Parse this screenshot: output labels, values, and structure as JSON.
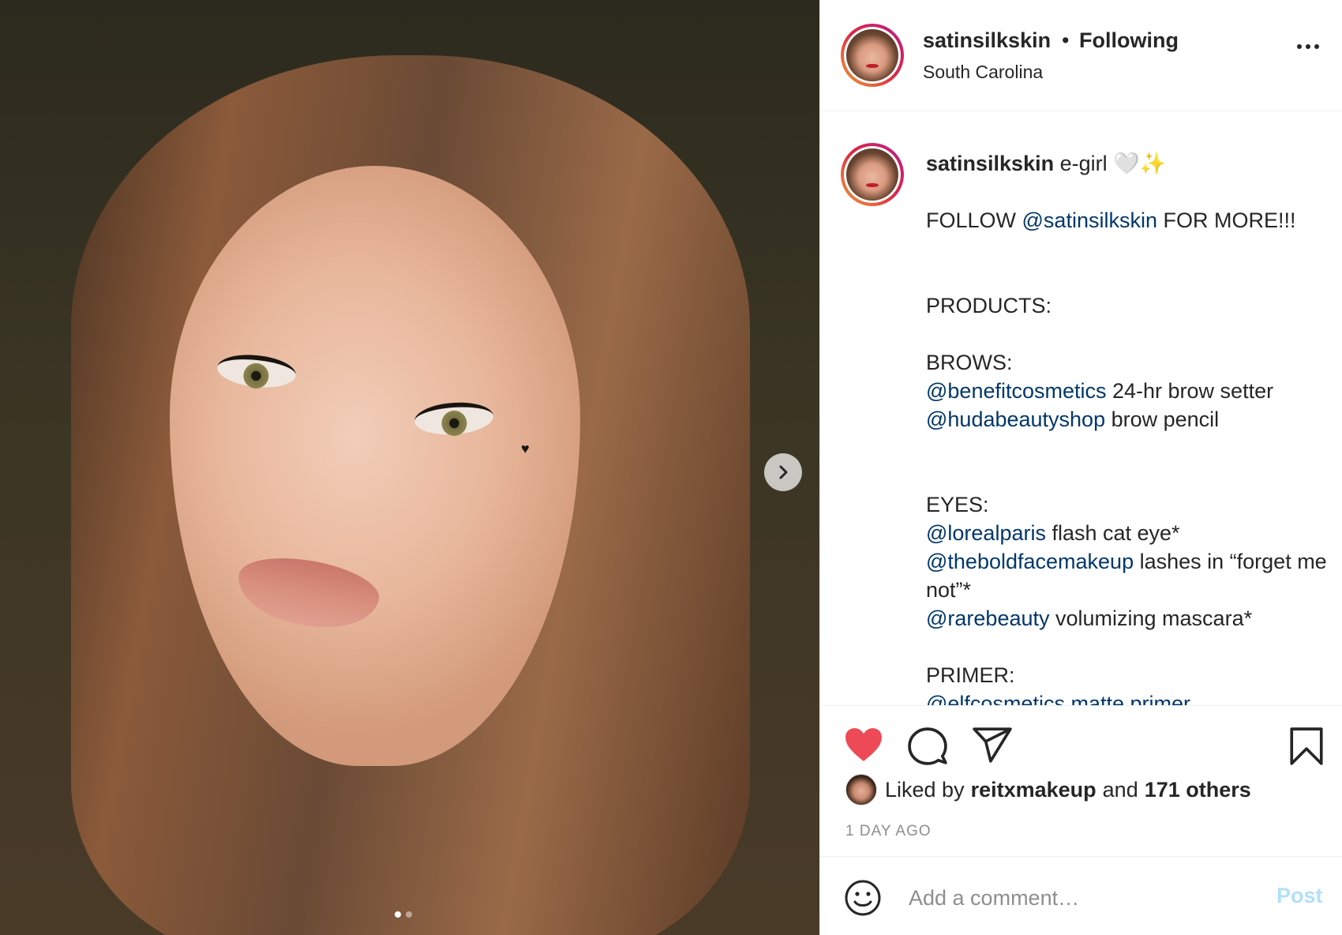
{
  "post": {
    "image_alt": "Selfie photo",
    "carousel": {
      "total": 2,
      "current": 1,
      "next_icon": "chevron-right-icon"
    }
  },
  "header": {
    "username": "satinsilkskin",
    "separator": "•",
    "following_label": "Following",
    "location": "South Carolina",
    "more_icon": "more-horizontal-icon"
  },
  "caption": {
    "username": "satinsilkskin",
    "title": "e-girl 🤍✨",
    "follow_prefix": "FOLLOW ",
    "follow_mention": "@satinsilkskin",
    "follow_suffix": " FOR MORE!!!",
    "products_heading": "PRODUCTS:",
    "brows_heading": "BROWS:",
    "brows": [
      {
        "mention": "@benefitcosmetics",
        "text": " 24-hr brow setter"
      },
      {
        "mention": "@hudabeautyshop",
        "text": " brow pencil"
      }
    ],
    "eyes_heading": "EYES:",
    "eyes": [
      {
        "mention": "@lorealparis",
        "text": " flash cat eye*"
      },
      {
        "mention": "@theboldfacemakeup",
        "text": " lashes in “forget me not”*"
      },
      {
        "mention": "@rarebeauty",
        "text": " volumizing mascara*"
      }
    ],
    "primer_heading": "PRIMER:",
    "primer_partial": "@elfcosmetics matte primer"
  },
  "actions": {
    "like_icon": "heart-filled-icon",
    "comment_icon": "comment-bubble-icon",
    "share_icon": "paper-plane-icon",
    "save_icon": "bookmark-icon",
    "liked_prefix": "Liked by",
    "liked_user": "reitxmakeup",
    "liked_and": "and",
    "liked_others": "171 others",
    "time_ago": "1 DAY AGO"
  },
  "comment_box": {
    "emoji_icon": "smiley-icon",
    "placeholder": "Add a comment…",
    "post_label": "Post"
  },
  "colors": {
    "like_red": "#ed4956",
    "mention_blue": "#00376b",
    "post_disabled": "#b2dffc",
    "muted": "#8e8e8e"
  }
}
